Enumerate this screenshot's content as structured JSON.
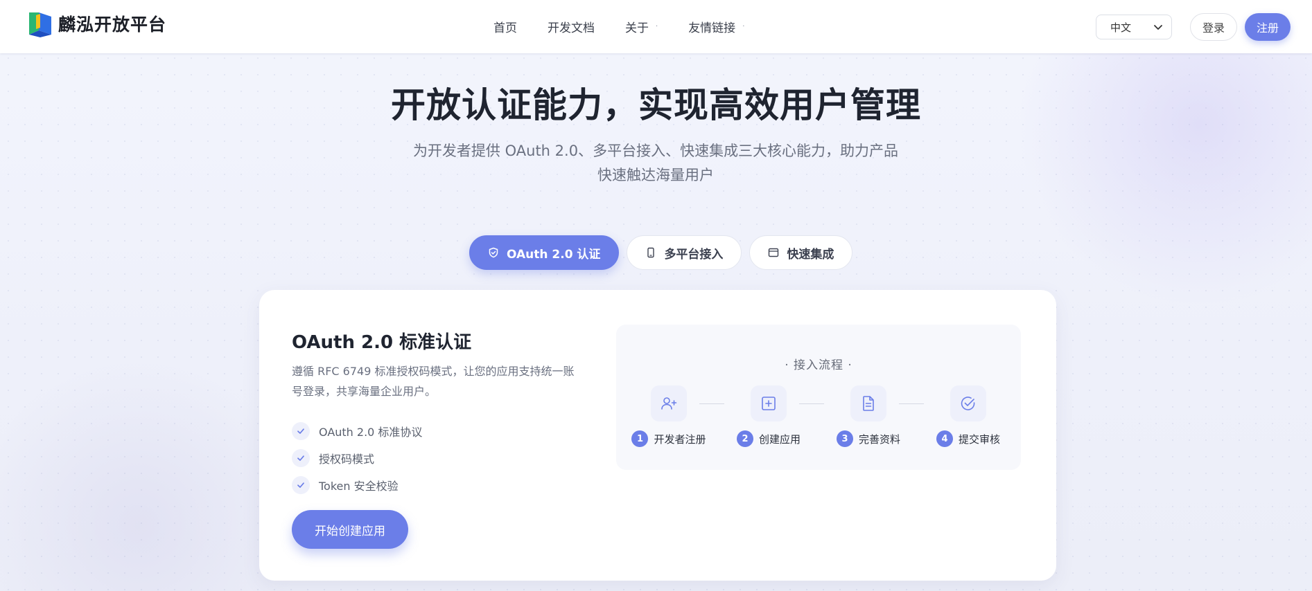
{
  "brand": {
    "name": "麟泓开放平台"
  },
  "nav": [
    {
      "label": "首页",
      "has_dropdown": false
    },
    {
      "label": "开发文档",
      "has_dropdown": false
    },
    {
      "label": "关于",
      "has_dropdown": true
    },
    {
      "label": "友情链接",
      "has_dropdown": true
    }
  ],
  "nav_dropdown_mark": "·",
  "language": {
    "selected": "中文"
  },
  "auth": {
    "login_label": "登录",
    "register_label": "注册"
  },
  "hero": {
    "title": "开放认证能力，实现高效用户管理",
    "subtitle": "为开发者提供 OAuth 2.0、多平台接入、快速集成三大核心能力，助力产品快速触达海量用户"
  },
  "tabs": [
    {
      "label": "OAuth 2.0 认证",
      "icon": "shield-check-icon",
      "active": true
    },
    {
      "label": "多平台接入",
      "icon": "phone-icon",
      "active": false
    },
    {
      "label": "快速集成",
      "icon": "window-icon",
      "active": false
    }
  ],
  "card": {
    "title": "OAuth 2.0 标准认证",
    "description": "遵循 RFC 6749 标准授权码模式，让您的应用支持统一账号登录，共享海量企业用户。",
    "features": [
      "OAuth 2.0 标准协议",
      "授权码模式",
      "Token 安全校验"
    ],
    "cta_label": "开始创建应用",
    "flow": {
      "title": "· 接入流程 ·",
      "steps": [
        {
          "num": "1",
          "label": "开发者注册",
          "icon": "user-add-icon"
        },
        {
          "num": "2",
          "label": "创建应用",
          "icon": "plus-square-icon"
        },
        {
          "num": "3",
          "label": "完善资料",
          "icon": "document-icon"
        },
        {
          "num": "4",
          "label": "提交审核",
          "icon": "check-circle-icon"
        }
      ]
    }
  },
  "colors": {
    "accent": "#6b7ee8",
    "background": "#eef1fb",
    "text": "#1f2430"
  }
}
